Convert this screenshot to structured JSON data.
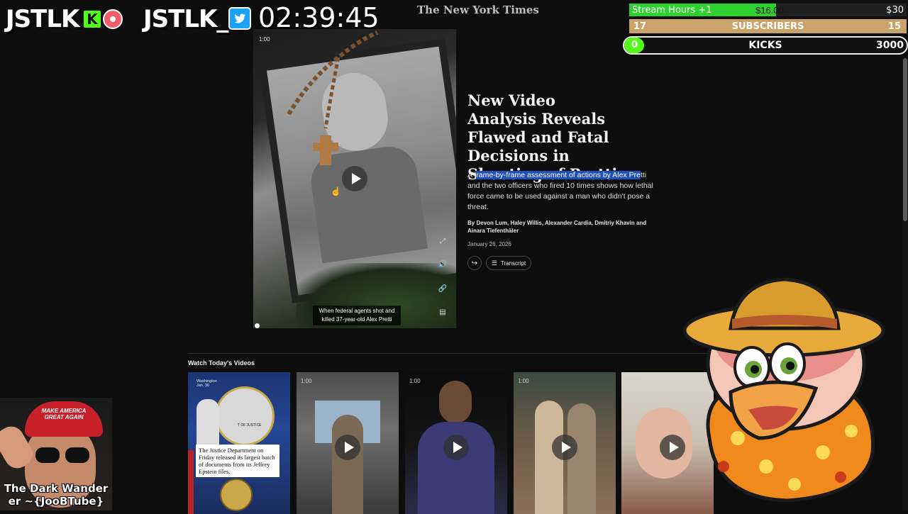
{
  "overlay": {
    "brand_kick": "JSTLK",
    "kick_letter": "K",
    "brand_twitter": "JSTLK_",
    "clock": "02:39:45"
  },
  "goals": {
    "stream_hours": {
      "label": "Stream Hours +1",
      "current": "$16.00",
      "target": "$30",
      "progress_percent": 53
    },
    "subscribers": {
      "count": "17",
      "label": "SUBSCRIBERS",
      "target": "15",
      "progress_percent": 100
    },
    "kicks": {
      "count": "0",
      "label": "KICKS",
      "target": "3000",
      "progress_percent": 0
    }
  },
  "nyt": {
    "logo": "The New York Times",
    "video": {
      "timestamp": "1:00",
      "caption": "When federal agents shot and killed 37-year-old Alex Pretti"
    },
    "headline": "New Video Analysis Reveals Flawed and Fatal Decisions in Shooting of Pretti",
    "summary_pre": "A f",
    "summary_highlight": "rame-by-frame assessment of actions by Alex Pre",
    "summary_post": "tti and the two officers who fired 10 times shows how lethal force came to be used against a man who didn't pose a threat.",
    "byline": "By Devon Lum, Haley Willis, Alexander Cardia, Dmitriy Khavin and Ainara Tiefenthäler",
    "date": "January 26, 2026",
    "transcript_label": "Transcript"
  },
  "videos_section": {
    "title": "Watch Today's Videos",
    "items": [
      {
        "duration": "",
        "overlay_top": "Washington\nJan. 30",
        "caption": "The Justice Department on Friday released its largest batch of documents from its Jeffrey Epstein files.",
        "emblem_text": "T OF JUSTICE"
      },
      {
        "duration": "1:00"
      },
      {
        "duration": "1:00"
      },
      {
        "duration": "1:00"
      },
      {
        "duration": "1:00"
      }
    ]
  },
  "webcam": {
    "hat_text_line1": "MAKE AMERICA",
    "hat_text_line2": "GREAT AGAIN",
    "name": "The Dark Wander er ~{JooBTube}"
  },
  "colors": {
    "kick_green": "#53fc18",
    "twitter_blue": "#1da1f2",
    "highlight_blue": "#1f4fb8",
    "goal_tan": "#c9a36a",
    "page_bg": "#0d0d0d"
  }
}
